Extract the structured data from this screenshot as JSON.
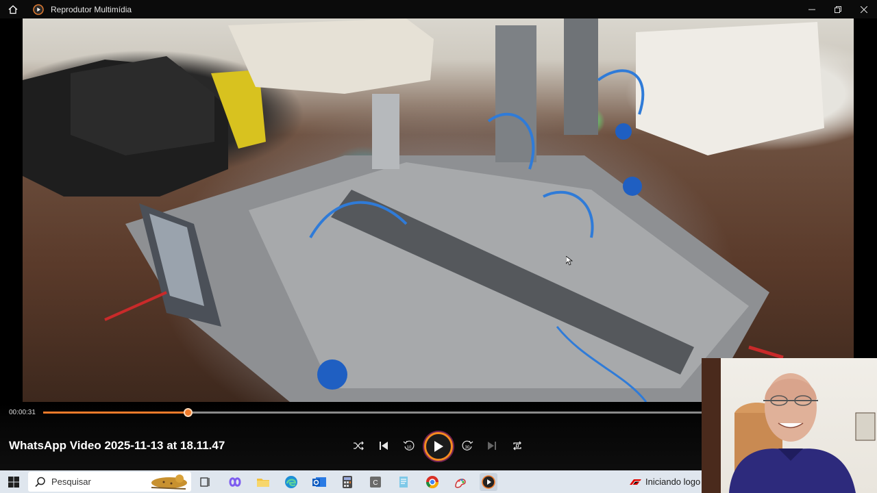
{
  "window": {
    "title": "Reprodutor Multimídia",
    "icons": {
      "home": "home-icon",
      "app": "media-player-icon",
      "minimize": "minimize-icon",
      "restore": "restore-icon",
      "close": "close-icon"
    }
  },
  "player": {
    "current_time": "00:00:31",
    "progress": 0.22,
    "video_title": "WhatsApp Video 2025-11-13 at 18.11.47",
    "controls": [
      {
        "name": "shuffle",
        "icon": "shuffle-icon"
      },
      {
        "name": "previous",
        "icon": "previous-icon"
      },
      {
        "name": "rewind-10",
        "icon": "rewind-10-icon",
        "label": "10"
      },
      {
        "name": "play",
        "icon": "play-icon"
      },
      {
        "name": "forward-30",
        "icon": "forward-30-icon",
        "label": "30"
      },
      {
        "name": "next",
        "icon": "next-icon"
      },
      {
        "name": "repeat",
        "icon": "repeat-icon"
      }
    ],
    "accent_color": "#f07a2a"
  },
  "taskbar": {
    "search_placeholder": "Pesquisar",
    "apps": [
      "task-view-icon",
      "copilot-icon",
      "file-explorer-icon",
      "edge-icon",
      "outlook-icon",
      "calculator-icon",
      "app-c-icon",
      "notepad-icon",
      "chrome-icon",
      "paint-icon",
      "media-player-icon"
    ],
    "tray_status": "Iniciando logo"
  }
}
